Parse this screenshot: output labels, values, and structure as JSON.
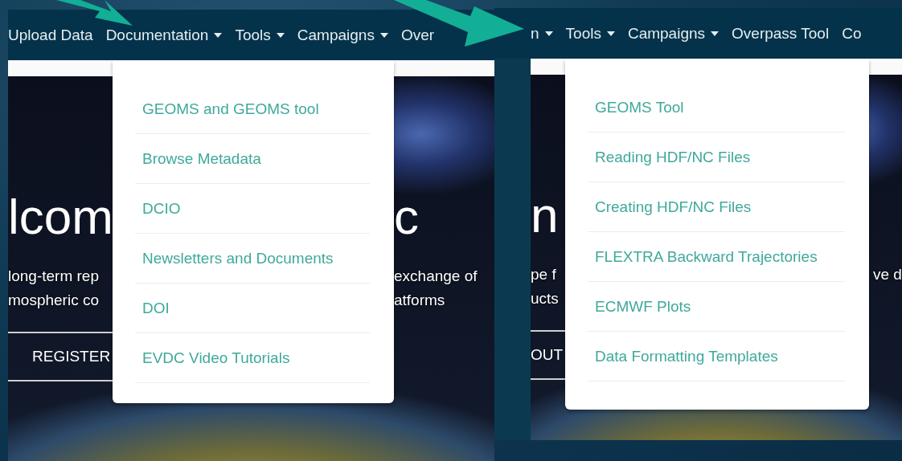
{
  "panels": [
    {
      "nav": [
        {
          "label": "Upload Data",
          "caret": false
        },
        {
          "label": "Documentation",
          "caret": true
        },
        {
          "label": "Tools",
          "caret": true
        },
        {
          "label": "Campaigns",
          "caret": true
        },
        {
          "label": "Over",
          "caret": false
        }
      ],
      "dropdown": {
        "items": [
          "GEOMS and GEOMS tool",
          "Browse Metadata",
          "DCIO",
          "Newsletters and Documents",
          "DOI",
          "EVDC Video Tutorials"
        ]
      },
      "hero": {
        "left": {
          "heading": "lcom",
          "lines": [
            "long-term rep",
            "mospheric co"
          ],
          "button": "REGISTER"
        },
        "right": {
          "heading": "c",
          "lines": [
            "exchange of",
            "atforms"
          ]
        }
      }
    },
    {
      "nav": [
        {
          "label": "n",
          "caret": true
        },
        {
          "label": "Tools",
          "caret": true
        },
        {
          "label": "Campaigns",
          "caret": true
        },
        {
          "label": "Overpass Tool",
          "caret": false
        },
        {
          "label": "Co",
          "caret": false
        }
      ],
      "dropdown": {
        "items": [
          "GEOMS Tool",
          "Reading HDF/NC Files",
          "Creating HDF/NC Files",
          "FLEXTRA Backward Trajectories",
          "ECMWF Plots",
          "Data Formatting Templates"
        ]
      },
      "hero": {
        "left": {
          "heading": "n",
          "lines": [
            "pe f",
            "ucts"
          ],
          "button": "OUT"
        },
        "right": {
          "lines": [
            "ve d"
          ]
        }
      }
    }
  ]
}
